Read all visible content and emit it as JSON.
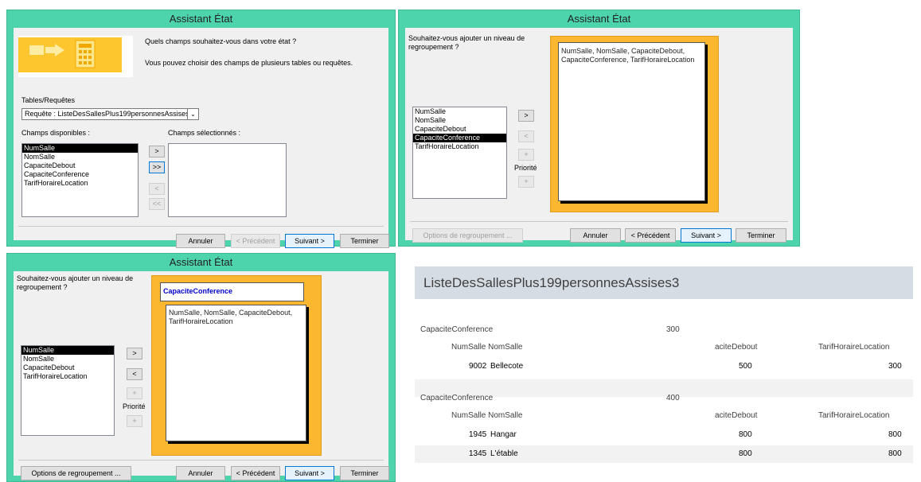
{
  "w1": {
    "title": "Assistant État",
    "question": "Quels champs souhaitez-vous dans votre état ?",
    "sub": "Vous pouvez choisir des champs de plusieurs tables ou requêtes.",
    "tables_label": "Tables/Requêtes",
    "tables_value": "Requête : ListeDesSallesPlus199personnesAssises",
    "available_label": "Champs disponibles :",
    "selected_label": "Champs sélectionnés :",
    "available": [
      "NumSalle",
      "NomSalle",
      "CapaciteDebout",
      "CapaciteConference",
      "TarifHoraireLocation"
    ],
    "btn_add": ">",
    "btn_add_all": ">>",
    "btn_remove": "<",
    "btn_remove_all": "<<",
    "cancel": "Annuler",
    "prev": "< Précédent",
    "next": "Suivant >",
    "finish": "Terminer"
  },
  "w2": {
    "title": "Assistant État",
    "question_l1": "Souhaitez-vous ajouter un niveau de",
    "question_l2": "regroupement ?",
    "list": [
      "NumSalle",
      "NomSalle",
      "CapaciteDebout",
      "CapaciteConference",
      "TarifHoraireLocation"
    ],
    "preview_l1": "NumSalle, NomSalle, CapaciteDebout,",
    "preview_l2": "CapaciteConference, TarifHoraireLocation",
    "btn_add": ">",
    "btn_remove": "<",
    "up": "+",
    "priority": "Priorité",
    "down": "+",
    "options": "Options de regroupement ...",
    "cancel": "Annuler",
    "prev": "< Précédent",
    "next": "Suivant >",
    "finish": "Terminer"
  },
  "w3": {
    "title": "Assistant État",
    "question_l1": "Souhaitez-vous ajouter un niveau de",
    "question_l2": "regroupement ?",
    "list": [
      "NumSalle",
      "NomSalle",
      "CapaciteDebout",
      "TarifHoraireLocation"
    ],
    "group_field": "CapaciteConference",
    "preview_l1": "NumSalle, NomSalle, CapaciteDebout,",
    "preview_l2": "TarifHoraireLocation",
    "btn_add": ">",
    "btn_remove": "<",
    "up": "+",
    "priority": "Priorité",
    "down": "+",
    "options": "Options de regroupement ...",
    "cancel": "Annuler",
    "prev": "< Précédent",
    "next": "Suivant >",
    "finish": "Terminer"
  },
  "report": {
    "title": "ListeDesSallesPlus199personnesAssises3",
    "groups": [
      {
        "label": "CapaciteConference",
        "value": "300",
        "h_num_nom": "NumSalle  NomSalle",
        "h_debout": "aciteDebout",
        "h_tarif": "TarifHoraireLocation",
        "rows": [
          {
            "num": "9002",
            "nom": "Bellecote",
            "debout": "500",
            "tarif": "300"
          }
        ]
      },
      {
        "label": "CapaciteConference",
        "value": "400",
        "h_num_nom": "NumSalle  NomSalle",
        "h_debout": "aciteDebout",
        "h_tarif": "TarifHoraireLocation",
        "rows": [
          {
            "num": "1945",
            "nom": "Hangar",
            "debout": "800",
            "tarif": "800"
          },
          {
            "num": "1345",
            "nom": "L'étable",
            "debout": "800",
            "tarif": "800"
          }
        ]
      }
    ]
  },
  "colors": {
    "titlebar": "#4ed4ad",
    "preview": "#fbb730",
    "report_title_bg": "#d6dce4",
    "group_blue": "#0000cc"
  }
}
